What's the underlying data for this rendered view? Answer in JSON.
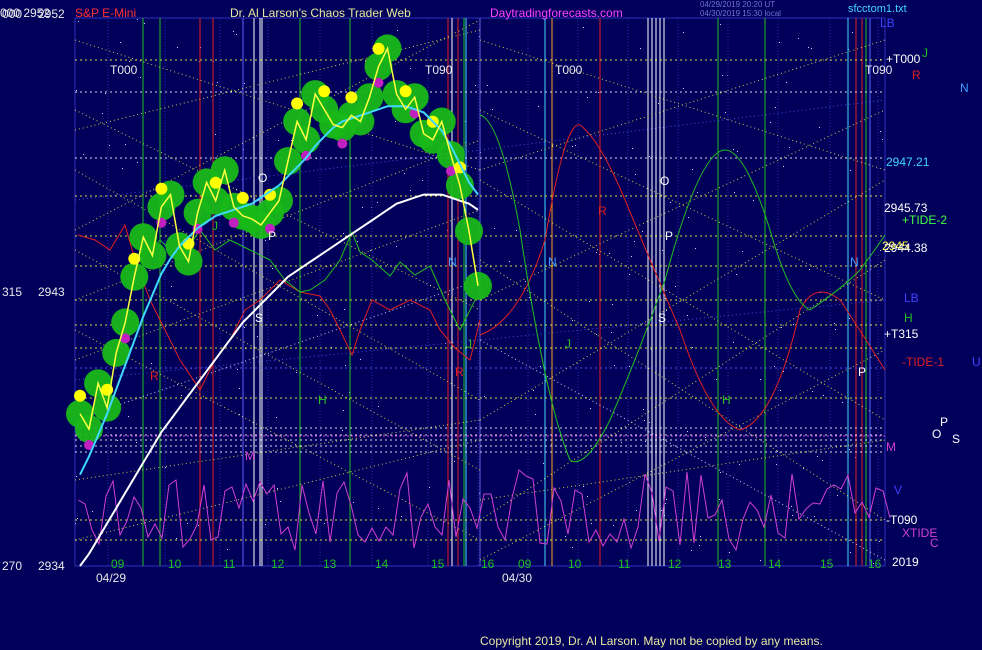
{
  "header": {
    "price_label": "000  2952",
    "symbol": "S&P E-Mini",
    "site_title": "Dr. Al Larson's Chaos Trader Web",
    "url": "Daytradingforecasts.com",
    "stamp_line1": "04/29/2019 20:20 UT",
    "stamp_line2": "04/30/2019 15:30 local",
    "file": "sfcctom1.txt"
  },
  "copyright": "Copyright 2019, Dr. Al Larson. May not be copied by any means.",
  "colors": {
    "background": "#00005a",
    "price_line": "#ffff40",
    "ma_fast": "#40d8ff",
    "ma_slow": "#ffffff",
    "ball_green": "#18b818",
    "ball_yellow": "#ffff00",
    "ball_magenta": "#c020c0",
    "tide_red": "#e02020",
    "tide_green": "#20c020",
    "xtide": "#d040d0"
  },
  "chart_data": {
    "type": "line",
    "title": "S&P E-Mini",
    "y_axis_left": [
      {
        "left": "000",
        "price": "2952"
      },
      {
        "left": "315",
        "price": "2943"
      },
      {
        "left": "270",
        "price": "2934"
      }
    ],
    "ylim": [
      2934,
      2952
    ],
    "x_dates": [
      "04/29",
      "04/30"
    ],
    "x_hours_day1": [
      "09",
      "10",
      "11",
      "12",
      "13",
      "14",
      "15",
      "16"
    ],
    "x_hours_day2": [
      "09",
      "10",
      "11",
      "12",
      "13",
      "14",
      "15",
      "16"
    ],
    "year": "2019",
    "right_labels": [
      {
        "text": "LB",
        "color": "#4040ff"
      },
      {
        "text": "+T000",
        "color": "#ffffff"
      },
      {
        "text": "J",
        "color": "#20c020"
      },
      {
        "text": "R",
        "color": "#e02020"
      },
      {
        "text": "N",
        "color": "#40a0ff"
      },
      {
        "text": "2947.21",
        "color": "#40d8ff"
      },
      {
        "text": "2945.73",
        "color": "#ffffff"
      },
      {
        "text": "+TIDE-2",
        "color": "#40ff40"
      },
      {
        "text": "2945",
        "color": "#ffff40"
      },
      {
        "text": "2944.38",
        "color": "#ffffff"
      },
      {
        "text": "LB",
        "color": "#4040ff"
      },
      {
        "text": "H",
        "color": "#20c020"
      },
      {
        "text": "+T315",
        "color": "#ffffff"
      },
      {
        "text": "-TIDE-1",
        "color": "#e02020"
      },
      {
        "text": "U",
        "color": "#4040ff"
      },
      {
        "text": "P",
        "color": "#ffffff"
      },
      {
        "text": "O",
        "color": "#ffffff"
      },
      {
        "text": "S",
        "color": "#ffffff"
      },
      {
        "text": "M",
        "color": "#d040d0"
      },
      {
        "text": "V",
        "color": "#4040ff"
      },
      {
        "text": "-T090",
        "color": "#ffffff"
      },
      {
        "text": "XTIDE",
        "color": "#d040d0"
      },
      {
        "text": "C",
        "color": "#d040d0"
      },
      {
        "text": "2019",
        "color": "#ffffff"
      }
    ],
    "time_markers": [
      "T000",
      "T090",
      "T000",
      "T090"
    ],
    "planet_labels": [
      "R",
      "J",
      "S",
      "P",
      "O",
      "N",
      "H",
      "M",
      "R",
      "J",
      "P",
      "O",
      "N",
      "S",
      "H",
      "R",
      "J",
      "N",
      "P"
    ],
    "price_series": [
      2939.0,
      2938.5,
      2940.0,
      2939.2,
      2941.0,
      2942.0,
      2943.5,
      2944.8,
      2944.2,
      2945.8,
      2946.2,
      2944.5,
      2944.0,
      2945.6,
      2946.6,
      2946.0,
      2947.0,
      2945.8,
      2945.5,
      2945.4,
      2945.2,
      2945.6,
      2946.0,
      2947.3,
      2948.6,
      2948.0,
      2949.5,
      2949.0,
      2948.5,
      2948.4,
      2948.8,
      2948.6,
      2949.4,
      2950.4,
      2951.0,
      2949.5,
      2949.0,
      2949.4,
      2948.2,
      2948.0,
      2948.6,
      2947.5,
      2946.5,
      2945.0,
      2943.2
    ],
    "ma_fast_series": [
      2937.0,
      2937.6,
      2938.3,
      2939.0,
      2939.8,
      2940.6,
      2941.4,
      2942.2,
      2942.9,
      2943.6,
      2944.1,
      2944.5,
      2944.8,
      2945.1,
      2945.3,
      2945.5,
      2945.6,
      2945.7,
      2945.8,
      2945.9,
      2946.1,
      2946.3,
      2946.5,
      2946.8,
      2947.1,
      2947.4,
      2947.8,
      2948.1,
      2948.4,
      2948.6,
      2948.7,
      2948.8,
      2948.9,
      2949.0,
      2949.1,
      2949.1,
      2949.1,
      2949.0,
      2948.9,
      2948.6,
      2948.3,
      2947.8,
      2947.2,
      2946.6,
      2946.2
    ],
    "ma_slow_series": [
      2934.0,
      2934.4,
      2934.9,
      2935.4,
      2935.9,
      2936.4,
      2936.9,
      2937.4,
      2937.9,
      2938.4,
      2938.8,
      2939.2,
      2939.6,
      2940.0,
      2940.4,
      2940.8,
      2941.2,
      2941.6,
      2942.0,
      2942.3,
      2942.6,
      2942.9,
      2943.2,
      2943.5,
      2943.7,
      2943.9,
      2944.1,
      2944.3,
      2944.5,
      2944.7,
      2944.9,
      2945.1,
      2945.3,
      2945.5,
      2945.7,
      2945.9,
      2946.0,
      2946.1,
      2946.2,
      2946.2,
      2946.2,
      2946.1,
      2946.0,
      2945.9,
      2945.7
    ]
  }
}
